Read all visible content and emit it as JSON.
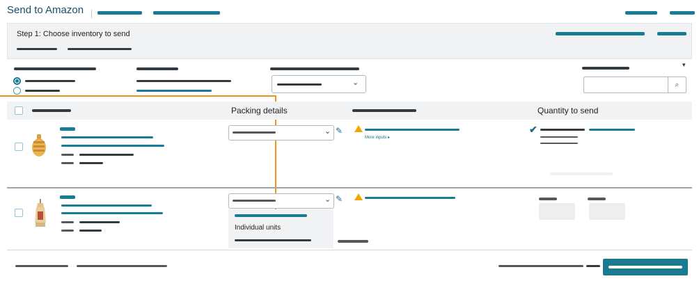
{
  "page": {
    "title": "Send to Amazon"
  },
  "step": {
    "label": "Step 1: Choose inventory to send"
  },
  "table": {
    "headers": {
      "packing_details": "Packing details",
      "quantity_to_send": "Quantity to send"
    }
  },
  "rows": [
    {
      "more_inputs_label": "More inputs ▸"
    },
    {
      "dropdown_option": "Individual units"
    }
  ],
  "icons": {
    "search": "search-icon",
    "chevron": "chevron-down-icon",
    "pencil": "pencil-icon",
    "warning": "warning-icon",
    "check": "check-icon",
    "dropdown": "caret-down-icon"
  },
  "colors": {
    "accent": "#1a7b96",
    "warning": "#f0a800",
    "callout": "#f0951a",
    "button": "#1b7a8f"
  }
}
